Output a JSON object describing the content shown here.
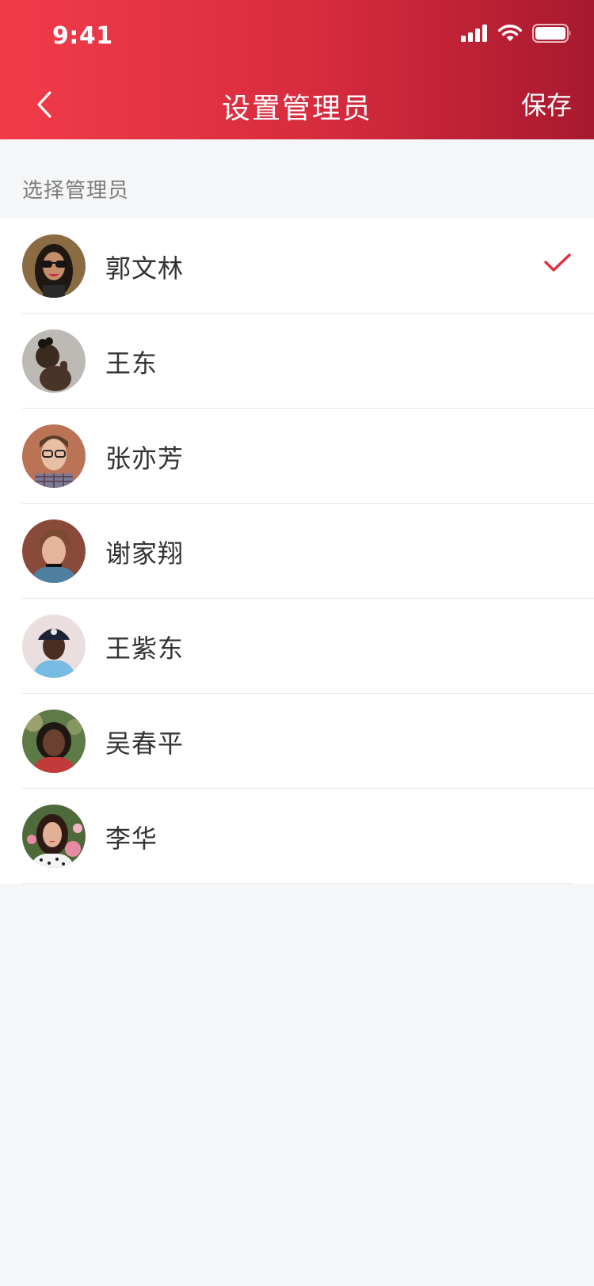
{
  "status_bar": {
    "time": "9:41"
  },
  "nav": {
    "title": "设置管理员",
    "save_label": "保存",
    "back_icon": "chevron-left-icon"
  },
  "section": {
    "label": "选择管理员"
  },
  "members": [
    {
      "name": "郭文林",
      "selected": true
    },
    {
      "name": "王东",
      "selected": false
    },
    {
      "name": "张亦芳",
      "selected": false
    },
    {
      "name": "谢家翔",
      "selected": false
    },
    {
      "name": "王紫东",
      "selected": false
    },
    {
      "name": "吴春平",
      "selected": false
    },
    {
      "name": "李华",
      "selected": false
    }
  ],
  "colors": {
    "accent": "#E0303F",
    "header_start": "#F23B49",
    "header_end": "#A8192E",
    "background": "#F5F6F8"
  }
}
